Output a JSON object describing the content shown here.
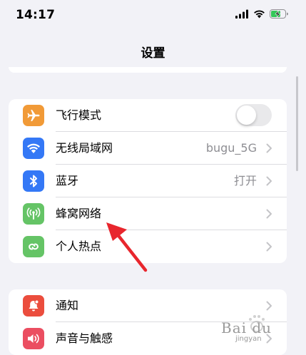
{
  "status_bar": {
    "time": "14:17",
    "icons": [
      "cellular-signal-icon",
      "wifi-icon",
      "battery-charging-icon"
    ]
  },
  "nav": {
    "title": "设置"
  },
  "group1": {
    "rows": [
      {
        "label": "飞行模式",
        "icon": "airplane-icon",
        "icon_bg": "#f19a37",
        "toggle": "off"
      },
      {
        "label": "无线局域网",
        "value": "bugu_5G",
        "icon": "wifi-icon",
        "icon_bg": "#3478f6"
      },
      {
        "label": "蓝牙",
        "value": "打开",
        "icon": "bluetooth-icon",
        "icon_bg": "#3478f6"
      },
      {
        "label": "蜂窝网络",
        "icon": "cellular-antenna-icon",
        "icon_bg": "#65c466"
      },
      {
        "label": "个人热点",
        "icon": "personal-hotspot-icon",
        "icon_bg": "#65c466"
      }
    ]
  },
  "group2": {
    "rows": [
      {
        "label": "通知",
        "icon": "notifications-icon",
        "icon_bg": "#eb4d3d"
      },
      {
        "label": "声音与触感",
        "icon": "sound-icon",
        "icon_bg": "#eb4e61"
      }
    ]
  },
  "annotation": {
    "arrow_color": "#e8262d",
    "arrow_target": "蜂窝网络"
  },
  "watermark": {
    "text": "Bai du",
    "sub": "jingyan"
  },
  "colors": {
    "background": "#f2f2f7",
    "separator": "#dcdce0",
    "secondary_text": "#8e8e93",
    "chevron": "#c4c4c7",
    "toggle_off": "#e9e9eb"
  }
}
